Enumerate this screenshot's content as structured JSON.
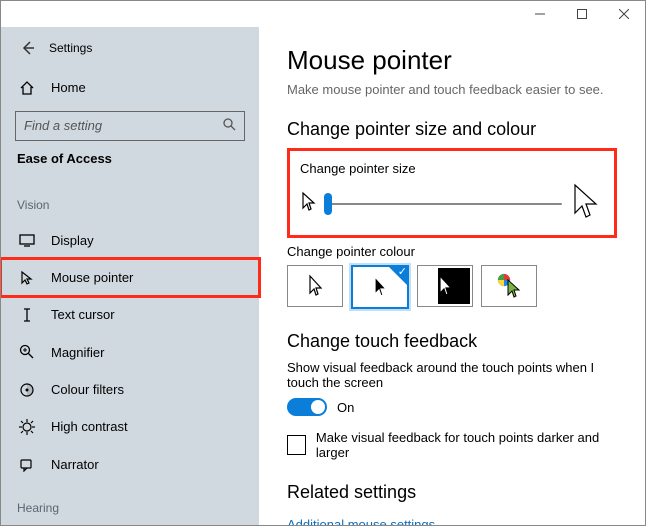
{
  "window": {
    "title": "Settings",
    "home": "Home",
    "search_placeholder": "Find a setting",
    "section": "Ease of Access",
    "group_vision": "Vision",
    "group_hearing": "Hearing",
    "nav": {
      "display": "Display",
      "mouse_pointer": "Mouse pointer",
      "text_cursor": "Text cursor",
      "magnifier": "Magnifier",
      "colour_filters": "Colour filters",
      "high_contrast": "High contrast",
      "narrator": "Narrator"
    }
  },
  "main": {
    "heading": "Mouse pointer",
    "intro": "Make mouse pointer and touch feedback easier to see.",
    "size_colour_h": "Change pointer size and colour",
    "size_label": "Change pointer size",
    "colour_label": "Change pointer colour",
    "touch_h": "Change touch feedback",
    "touch_text": "Show visual feedback around the touch points when I touch the screen",
    "toggle_state": "On",
    "touch_check": "Make visual feedback for touch points darker and larger",
    "related_h": "Related settings",
    "related_link": "Additional mouse settings"
  }
}
